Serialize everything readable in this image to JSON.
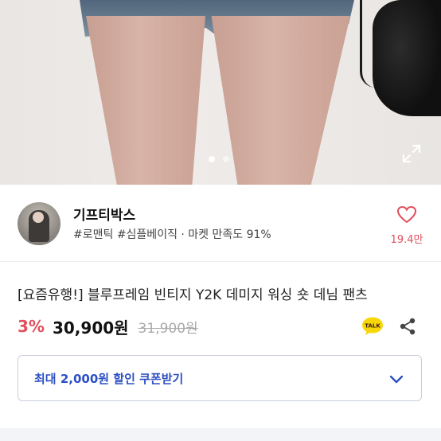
{
  "gallery": {
    "total_images": 2,
    "current_index": 0
  },
  "seller": {
    "name": "기프티박스",
    "tags": "#로맨틱 #심플베이직 · 마켓 만족도 91%",
    "like_count": "19.4만"
  },
  "product": {
    "title": "[요즘유행!] 블루프레임 빈티지 Y2K 데미지 워싱 숏 데님 팬츠",
    "discount": "3%",
    "price": "30,900원",
    "original_price": "31,900원",
    "talk_icon_text": "TALK"
  },
  "coupon": {
    "label": "최대 2,000원 할인 쿠폰받기"
  },
  "colors": {
    "accent_red": "#e0505e",
    "coupon_blue": "#2d4fc4",
    "talk_yellow": "#f7d708"
  },
  "icons": {
    "expand": "expand-icon",
    "heart": "heart-icon",
    "talk": "kakaotalk-icon",
    "share": "share-icon",
    "chevron": "chevron-down-icon"
  }
}
